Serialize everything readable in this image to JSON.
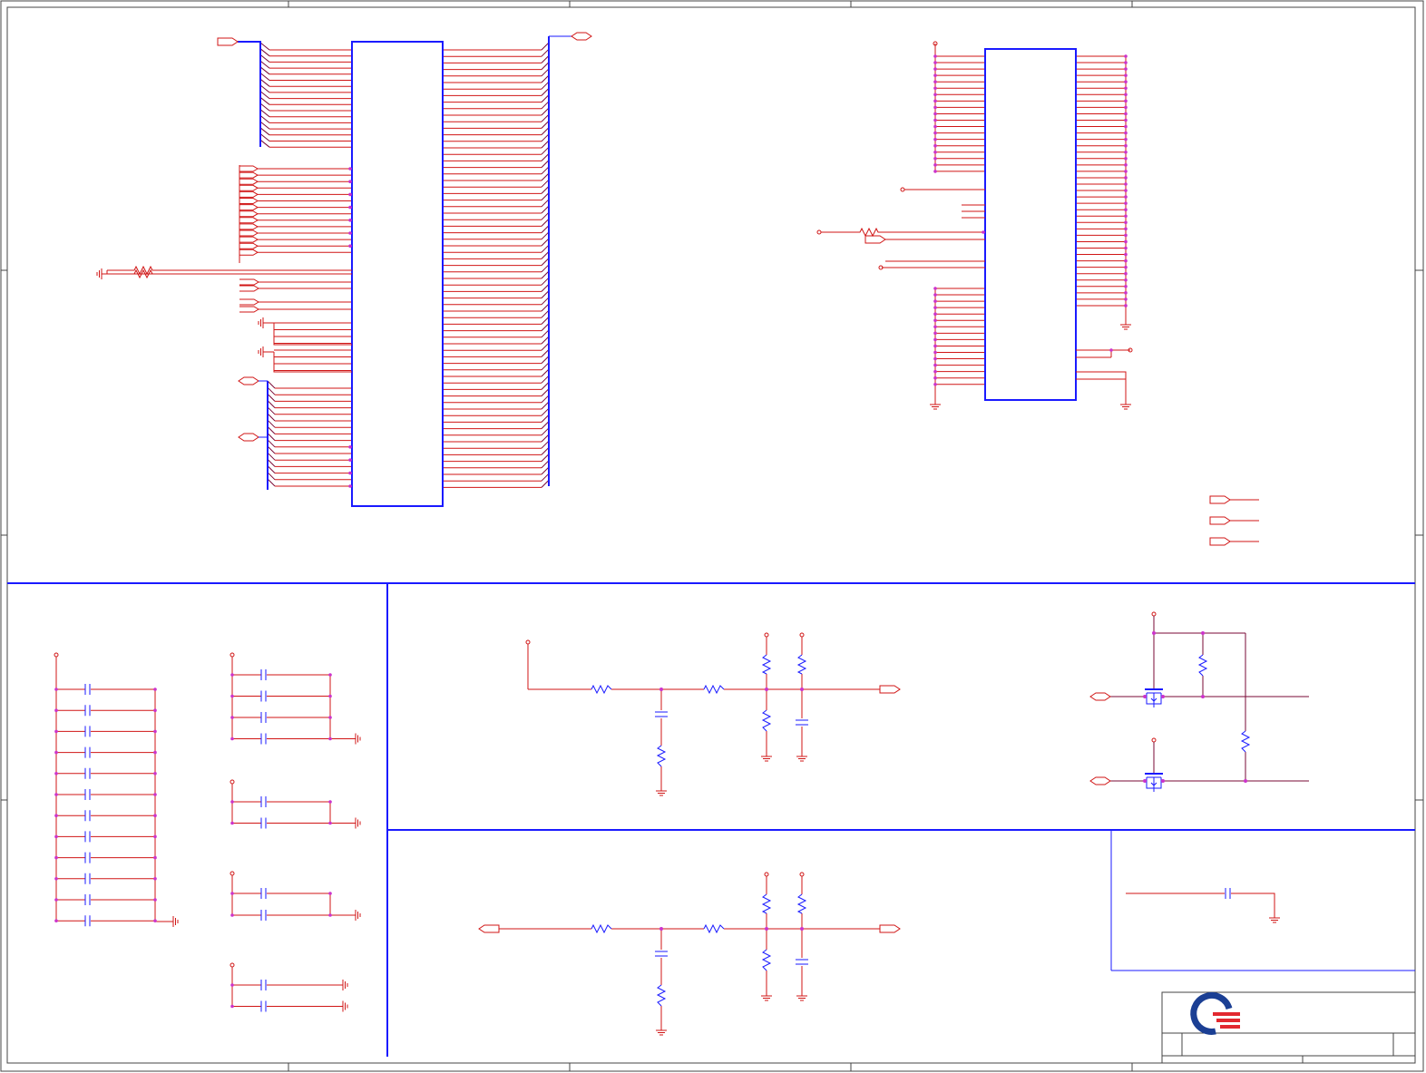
{
  "sheet": {
    "title_block": {
      "logo": "q-company-logo"
    }
  },
  "colors": {
    "background": "#ffffff",
    "bus_and_border": "#1a1aff",
    "net_wire": "#d01515",
    "bus_entry": "#7a0a35",
    "junction": "#cc33cc",
    "component": "#1a1aff",
    "frame": "#444444",
    "logo_blue": "#1b3f94",
    "logo_red": "#e2282f"
  },
  "icons": [
    "resistor-icon",
    "capacitor-icon",
    "ground-icon",
    "mosfet-icon",
    "off-page-connector-icon",
    "power-port-icon",
    "company-logo-icon"
  ]
}
